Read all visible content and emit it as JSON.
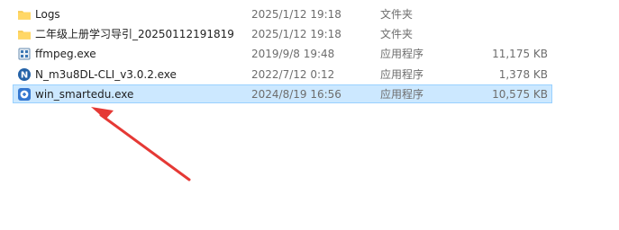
{
  "files": [
    {
      "name": "Logs",
      "modified": "2025/1/12 19:18",
      "type": "文件夹",
      "size": "",
      "icon": "folder-icon",
      "selected": false
    },
    {
      "name": "二年级上册学习导引_20250112191819",
      "modified": "2025/1/12 19:18",
      "type": "文件夹",
      "size": "",
      "icon": "folder-icon",
      "selected": false
    },
    {
      "name": "ffmpeg.exe",
      "modified": "2019/9/8 19:48",
      "type": "应用程序",
      "size": "11,175 KB",
      "icon": "ffmpeg-app-icon",
      "selected": false
    },
    {
      "name": "N_m3u8DL-CLI_v3.0.2.exe",
      "modified": "2022/7/12 0:12",
      "type": "应用程序",
      "size": "1,378 KB",
      "icon": "n-m3u8dl-app-icon",
      "selected": false
    },
    {
      "name": "win_smartedu.exe",
      "modified": "2024/8/19 16:56",
      "type": "应用程序",
      "size": "10,575 KB",
      "icon": "smartedu-app-icon",
      "selected": true
    }
  ],
  "annotation": {
    "type": "arrow",
    "target": "win_smartedu.exe",
    "color": "#e53935"
  },
  "colors": {
    "selected_background": "#cce8ff",
    "selected_border": "#99d1ff",
    "folder": "#f5c542",
    "annotation": "#e53935"
  }
}
